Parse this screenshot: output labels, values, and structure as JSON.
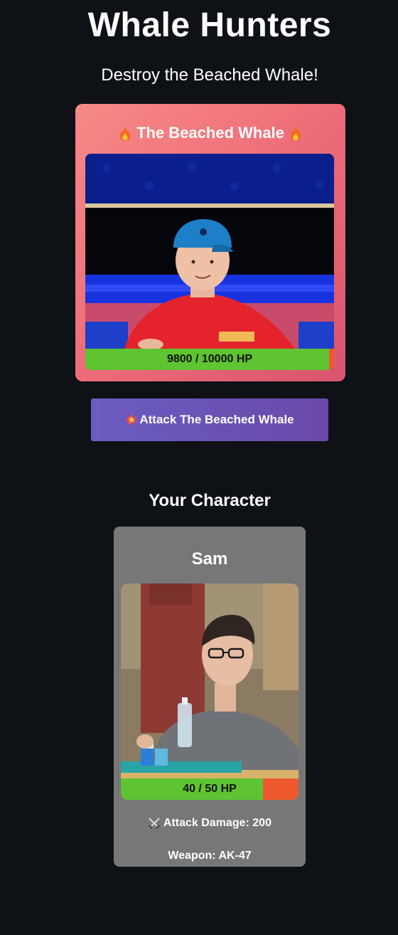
{
  "header": {
    "title": "Whale Hunters",
    "subtitle": "Destroy the Beached Whale!"
  },
  "boss": {
    "name": "The Beached Whale",
    "hp_text": "9800 / 10000 HP",
    "hp_current": 9800,
    "hp_max": 10000
  },
  "actions": {
    "attack_label": "Attack The Beached Whale"
  },
  "character_section": {
    "heading": "Your Character"
  },
  "character": {
    "name": "Sam",
    "hp_text": "40 / 50 HP",
    "hp_current": 40,
    "hp_max": 50,
    "attack_damage": "Attack Damage: 200",
    "weapon": "Weapon: AK-47"
  },
  "icons": {
    "title_left": "fire-icon",
    "title_right": "fire-icon",
    "attack": "explosion-icon",
    "damage": "crossed-swords-icon"
  },
  "colors": {
    "background": "#0e1116",
    "hp_fill": "#5ec431",
    "hp_empty": "#ee5a2d",
    "button": "#6a5cc2",
    "char_card": "#777777"
  }
}
